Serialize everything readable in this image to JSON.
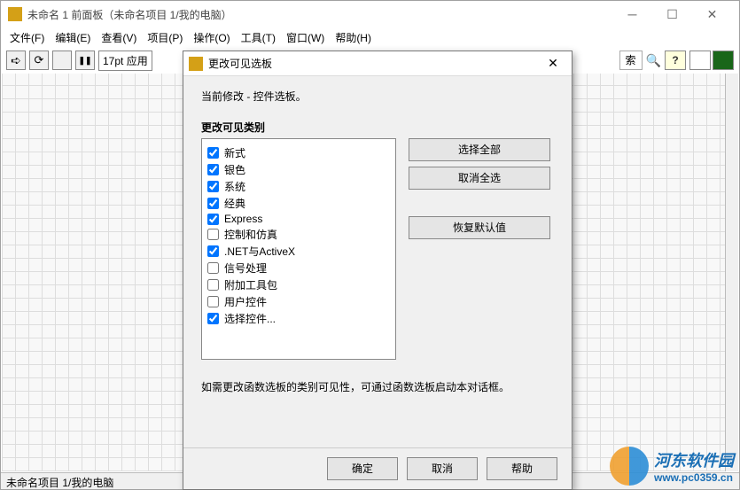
{
  "window": {
    "title": "未命名 1 前面板（未命名项目 1/我的电脑）"
  },
  "menubar": [
    "文件(F)",
    "编辑(E)",
    "查看(V)",
    "项目(P)",
    "操作(O)",
    "工具(T)",
    "窗口(W)",
    "帮助(H)"
  ],
  "toolbar": {
    "font": "17pt 应用"
  },
  "search_placeholder": "索",
  "dialog": {
    "title": "更改可见选板",
    "current_modify": "当前修改 - 控件选板。",
    "section_label": "更改可见类别",
    "items": [
      {
        "label": "新式",
        "checked": true
      },
      {
        "label": "银色",
        "checked": true
      },
      {
        "label": "系统",
        "checked": true
      },
      {
        "label": "经典",
        "checked": true
      },
      {
        "label": "Express",
        "checked": true
      },
      {
        "label": "控制和仿真",
        "checked": false
      },
      {
        "label": ".NET与ActiveX",
        "checked": true
      },
      {
        "label": "信号处理",
        "checked": false
      },
      {
        "label": "附加工具包",
        "checked": false
      },
      {
        "label": "用户控件",
        "checked": false
      },
      {
        "label": "选择控件...",
        "checked": true
      }
    ],
    "select_all": "选择全部",
    "deselect_all": "取消全选",
    "restore_default": "恢复默认值",
    "hint": "如需更改函数选板的类别可见性，可通过函数选板启动本对话框。",
    "ok": "确定",
    "cancel": "取消",
    "help": "帮助"
  },
  "statusbar": "未命名项目 1/我的电脑",
  "watermark": {
    "cn": "河东软件园",
    "url": "www.pc0359.cn"
  }
}
